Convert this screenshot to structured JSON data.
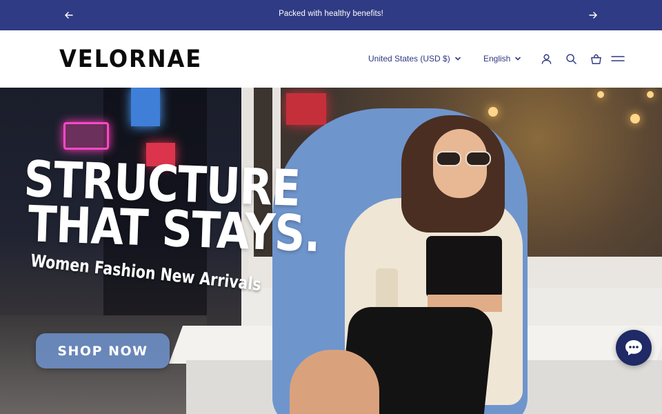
{
  "announcement": {
    "message": "Packed with healthy benefits!",
    "prev_icon": "arrow-left-icon",
    "next_icon": "arrow-right-icon"
  },
  "header": {
    "logo": "VELORNAE",
    "country_selector": "United States (USD $)",
    "language_selector": "English",
    "icons": [
      "account-icon",
      "search-icon",
      "cart-icon",
      "menu-icon"
    ]
  },
  "hero": {
    "headline_line1": "STRUCTURE",
    "headline_line2": "THAT STAYS.",
    "subheadline": "Women Fashion New Arrivals",
    "cta_label": "SHOP NOW"
  },
  "chat": {
    "icon": "chat-bubble-icon"
  },
  "colors": {
    "announcement_bg": "#2f3b84",
    "nav_text": "#2e3782",
    "cta_bg": "#6f92cd",
    "chat_bg": "#1f2a66"
  }
}
